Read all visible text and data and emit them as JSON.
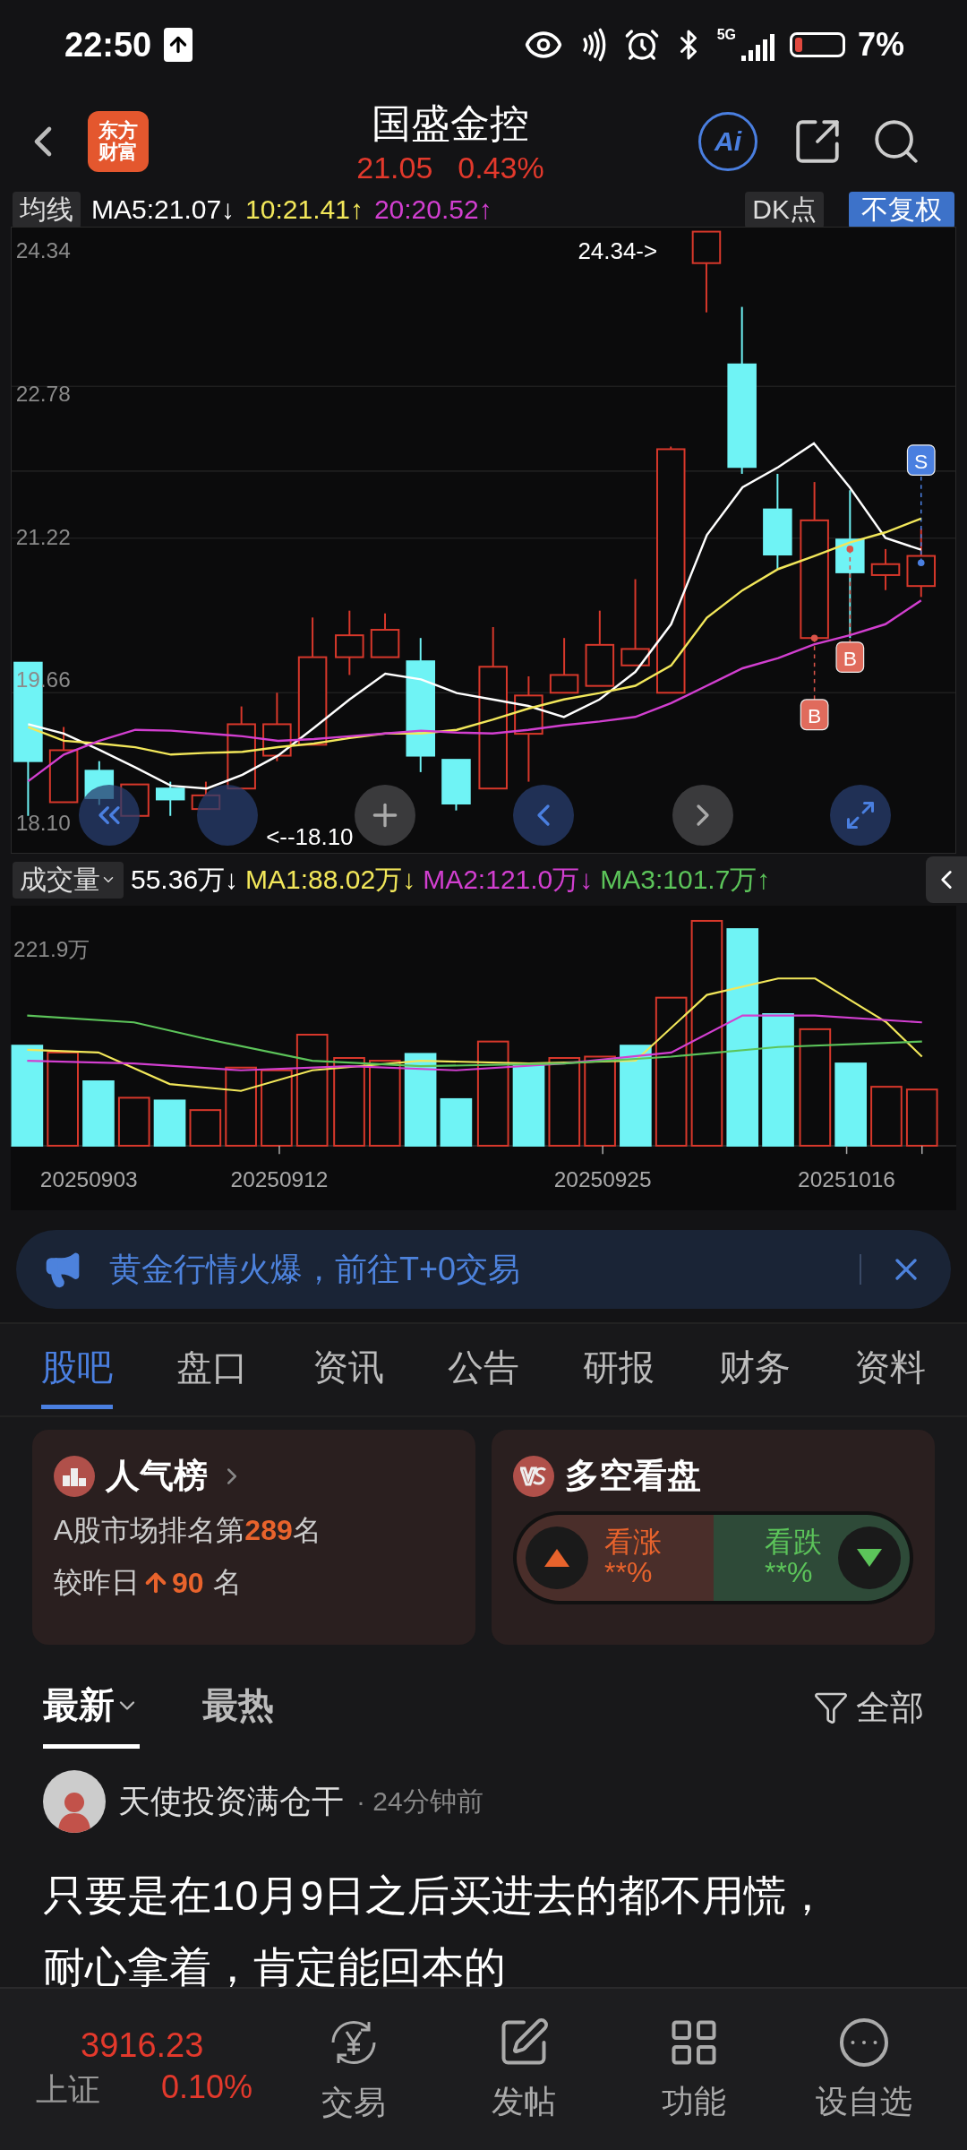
{
  "status_bar": {
    "time": "22:50",
    "network": "5G",
    "battery": "7%"
  },
  "header": {
    "logo": [
      "东方",
      "财富"
    ],
    "title": "国盛金控",
    "price": "21.05",
    "change": "0.43%",
    "ai_label": "Ai"
  },
  "chart_legend": {
    "indicator": "均线",
    "readings": [
      ":21.07↓",
      ":21.41↑",
      ":20.52↑"
    ],
    "dk": "DK点",
    "adjust": "不复权"
  },
  "price_chart": {
    "chart_data": {
      "type": "line",
      "ylim": [
        17.77,
        24.58
      ],
      "yticks": [
        {
          "value": 24.34,
          "label": "24.34"
        },
        {
          "value": 22.78,
          "label": "22.78"
        },
        {
          "value": 21.22,
          "label": "21.22"
        },
        {
          "value": 19.66,
          "label": "19.66"
        },
        {
          "value": 18.1,
          "label": "18.10"
        }
      ],
      "series": [
        {
          "name": "MA5",
          "color": "#ffffff",
          "values": [
            19.17,
            19.07,
            18.89,
            18.7,
            18.5,
            18.47,
            18.62,
            18.83,
            19.13,
            19.44,
            19.72,
            19.66,
            19.51,
            19.44,
            19.37,
            19.25,
            19.44,
            19.74,
            20.26,
            21.23,
            21.75,
            21.97,
            22.23,
            21.75,
            21.2,
            21.07
          ]
        },
        {
          "name": "10",
          "color": "#f2e75a",
          "values": [
            19.14,
            18.99,
            18.96,
            18.92,
            18.84,
            18.86,
            18.87,
            18.92,
            18.96,
            19.02,
            19.07,
            19.07,
            19.11,
            19.22,
            19.34,
            19.44,
            19.51,
            19.59,
            19.81,
            20.33,
            20.63,
            20.86,
            21.0,
            21.15,
            21.26,
            21.41
          ]
        },
        {
          "name": "20",
          "color": "#d23fd0",
          "values": [
            18.55,
            18.84,
            18.99,
            19.11,
            19.1,
            19.07,
            19.04,
            18.99,
            19.01,
            19.04,
            19.07,
            19.1,
            19.08,
            19.07,
            19.11,
            19.16,
            19.2,
            19.25,
            19.4,
            19.59,
            19.78,
            19.89,
            20.04,
            20.14,
            20.26,
            20.52
          ]
        }
      ]
    },
    "high_note": "24.34->",
    "low_note": "<--18.10",
    "signals": [
      {
        "label": "B"
      },
      {
        "label": "B"
      },
      {
        "label": "S"
      }
    ]
  },
  "volume_legend": {
    "indicator": "成交量",
    "items": [
      {
        "text": "55.36万↓",
        "color": "#ffffff"
      },
      {
        "text": "MA1:88.02万↓",
        "color": "#f2e75a"
      },
      {
        "text": "MA2:121.0万↓",
        "color": "#d23fd0"
      },
      {
        "text": "MA3:101.7万↑",
        "color": "#5cc45a"
      }
    ]
  },
  "volume_chart": {
    "max_label": "221.9万",
    "dates": [
      "20250903",
      "20250912",
      "20250925",
      "20251016"
    ]
  },
  "banner": {
    "text": "黄金行情火爆，前往T+0交易"
  },
  "tabs": [
    {
      "label": "股吧",
      "selected": true
    },
    {
      "label": "盘口",
      "selected": false
    },
    {
      "label": "资讯",
      "selected": false
    },
    {
      "label": "公告",
      "selected": false
    },
    {
      "label": "研报",
      "selected": false
    },
    {
      "label": "财务",
      "selected": false
    },
    {
      "label": "资料",
      "selected": false
    }
  ],
  "popularity": {
    "title": "人气榜",
    "rank_text": "A股市场排名第**289**名",
    "change_label": "较昨日",
    "change_value": "90",
    "change_unit": "名"
  },
  "sentiment": {
    "title": "多空看盘",
    "bull_label": "看涨",
    "bull_value": "**%",
    "bear_label": "看跌",
    "bear_value": "**%"
  },
  "sort": [
    {
      "label": "最新",
      "selected": true
    },
    {
      "label": "最热",
      "selected": false
    }
  ],
  "filter": "全部",
  "post": {
    "author": "天使投资满仓干",
    "time": "· 24分钟前",
    "text": "只要是在10月9日之后买进去的都不用慌，耐心拿着，肯定能回本的"
  },
  "bottom_nav": {
    "index": {
      "value": "3916.23",
      "name": "上证",
      "change": "0.10%"
    },
    "items": [
      {
        "label": "交易",
        "kind": "trade"
      },
      {
        "label": "发帖",
        "kind": "post"
      },
      {
        "label": "功能",
        "kind": "grid"
      },
      {
        "label": "设自选",
        "kind": "watch"
      }
    ]
  }
}
